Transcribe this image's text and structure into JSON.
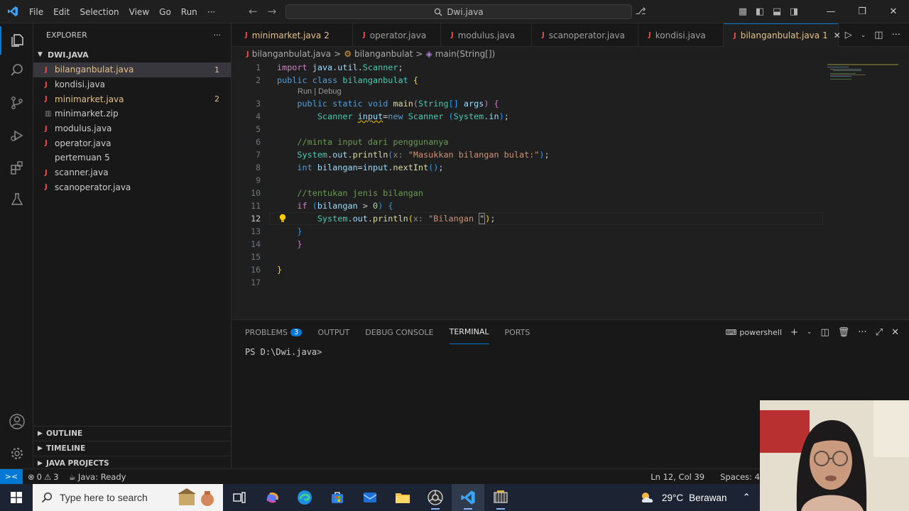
{
  "titlebar": {
    "menu": [
      "File",
      "Edit",
      "Selection",
      "View",
      "Go",
      "Run",
      "···"
    ],
    "search": "Dwi.java"
  },
  "explorer": {
    "header": "EXPLORER",
    "more": "···",
    "folder": "DWI.JAVA",
    "files": [
      {
        "name": "bilanganbulat.java",
        "type": "java",
        "badge": "1",
        "status": "modified"
      },
      {
        "name": "kondisi.java",
        "type": "java",
        "badge": "",
        "status": "normal"
      },
      {
        "name": "minimarket.java",
        "type": "java",
        "badge": "2",
        "status": "modified"
      },
      {
        "name": "minimarket.zip",
        "type": "zip",
        "badge": "",
        "status": "normal"
      },
      {
        "name": "modulus.java",
        "type": "java",
        "badge": "",
        "status": "normal"
      },
      {
        "name": "operator.java",
        "type": "java",
        "badge": "",
        "status": "normal"
      },
      {
        "name": "pertemuan 5",
        "type": "folder",
        "badge": "",
        "status": "normal"
      },
      {
        "name": "scanner.java",
        "type": "java",
        "badge": "",
        "status": "normal"
      },
      {
        "name": "scanoperator.java",
        "type": "java",
        "badge": "",
        "status": "normal"
      }
    ],
    "sections": [
      "OUTLINE",
      "TIMELINE",
      "JAVA PROJECTS"
    ]
  },
  "tabs": [
    {
      "label": "minimarket.java",
      "badge": "2"
    },
    {
      "label": "operator.java",
      "badge": ""
    },
    {
      "label": "modulus.java",
      "badge": ""
    },
    {
      "label": "scanoperator.java",
      "badge": ""
    },
    {
      "label": "kondisi.java",
      "badge": ""
    },
    {
      "label": "bilanganbulat.java",
      "badge": "1"
    }
  ],
  "breadcrumb": [
    "bilanganbulat.java",
    ">",
    "bilanganbulat",
    ">",
    "main(String[])"
  ],
  "editor": {
    "codelens": "Run | Debug",
    "line_numbers": [
      "1",
      "2",
      "3",
      "4",
      "5",
      "6",
      "7",
      "8",
      "9",
      "10",
      "11",
      "12",
      "13",
      "14",
      "15",
      "16",
      "17"
    ],
    "current_line": "12"
  },
  "panel": {
    "tabs": [
      "PROBLEMS",
      "OUTPUT",
      "DEBUG CONSOLE",
      "TERMINAL",
      "PORTS"
    ],
    "problems_count": "3",
    "shell": "powershell",
    "terminal_prompt": "PS D:\\Dwi.java>"
  },
  "statusbar": {
    "errors": "0",
    "warnings": "3",
    "java_status": "Java: Ready",
    "position": "Ln 12, Col 39",
    "spaces": "Spaces: 4"
  },
  "taskbar": {
    "search_placeholder": "Type here to search",
    "temperature": "29°C",
    "weather": "Berawan"
  }
}
